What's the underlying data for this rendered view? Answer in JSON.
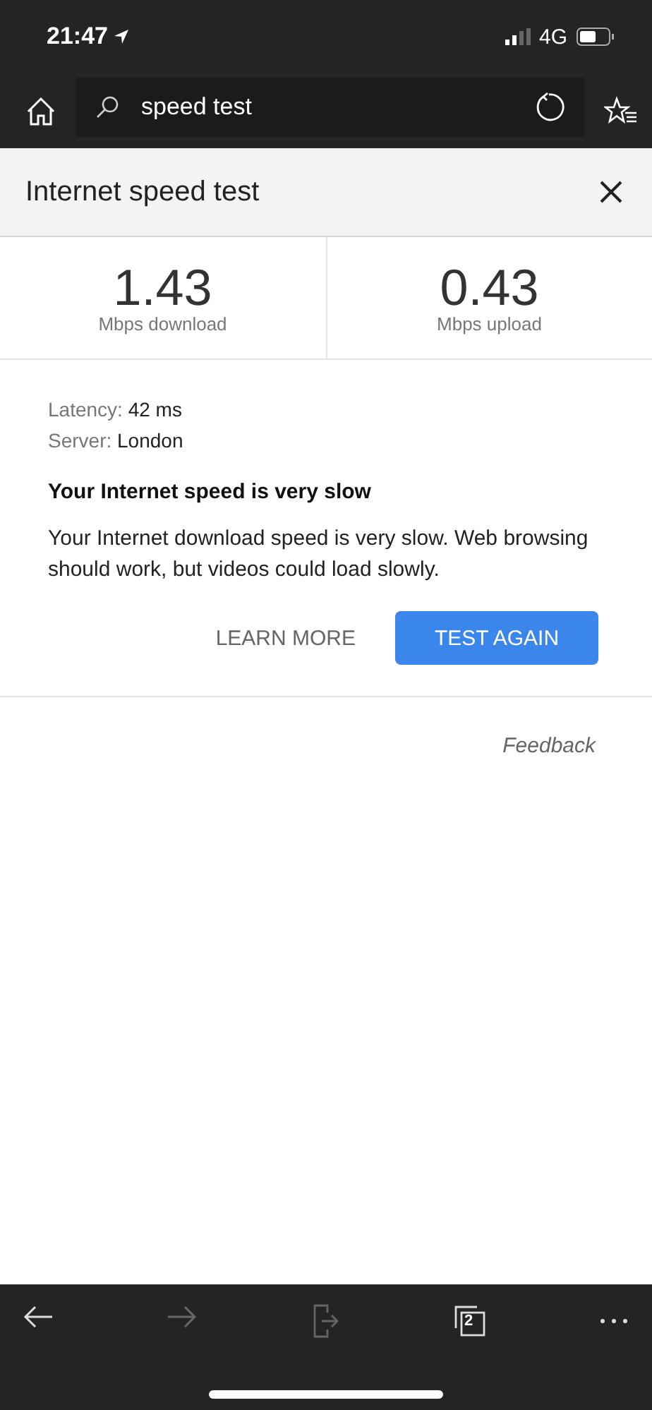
{
  "status_bar": {
    "time": "21:47",
    "network": "4G"
  },
  "browser_bar": {
    "search": {
      "value": "speed test"
    }
  },
  "panel": {
    "title": "Internet speed test",
    "metrics": [
      {
        "value": "1.43",
        "unit": "Mbps download"
      },
      {
        "value": "0.43",
        "unit": "Mbps upload"
      }
    ],
    "details": [
      {
        "label": "Latency:",
        "value": "42 ms"
      },
      {
        "label": "Server:",
        "value": "London"
      }
    ],
    "heading": "Your Internet speed is very slow",
    "message": "Your Internet download speed is very slow. Web browsing should work, but videos could load slowly.",
    "buttons": [
      {
        "label": "LEARN MORE",
        "kind": "text"
      },
      {
        "label": "TEST AGAIN",
        "kind": "primary"
      }
    ],
    "feedback": "Feedback"
  },
  "bottom_bar": {
    "items": [
      {
        "kind": "back",
        "disabled": false
      },
      {
        "kind": "forward",
        "disabled": true
      },
      {
        "kind": "share",
        "disabled": true
      },
      {
        "kind": "tabs",
        "count": "2",
        "disabled": false
      },
      {
        "kind": "more",
        "disabled": false
      }
    ]
  }
}
